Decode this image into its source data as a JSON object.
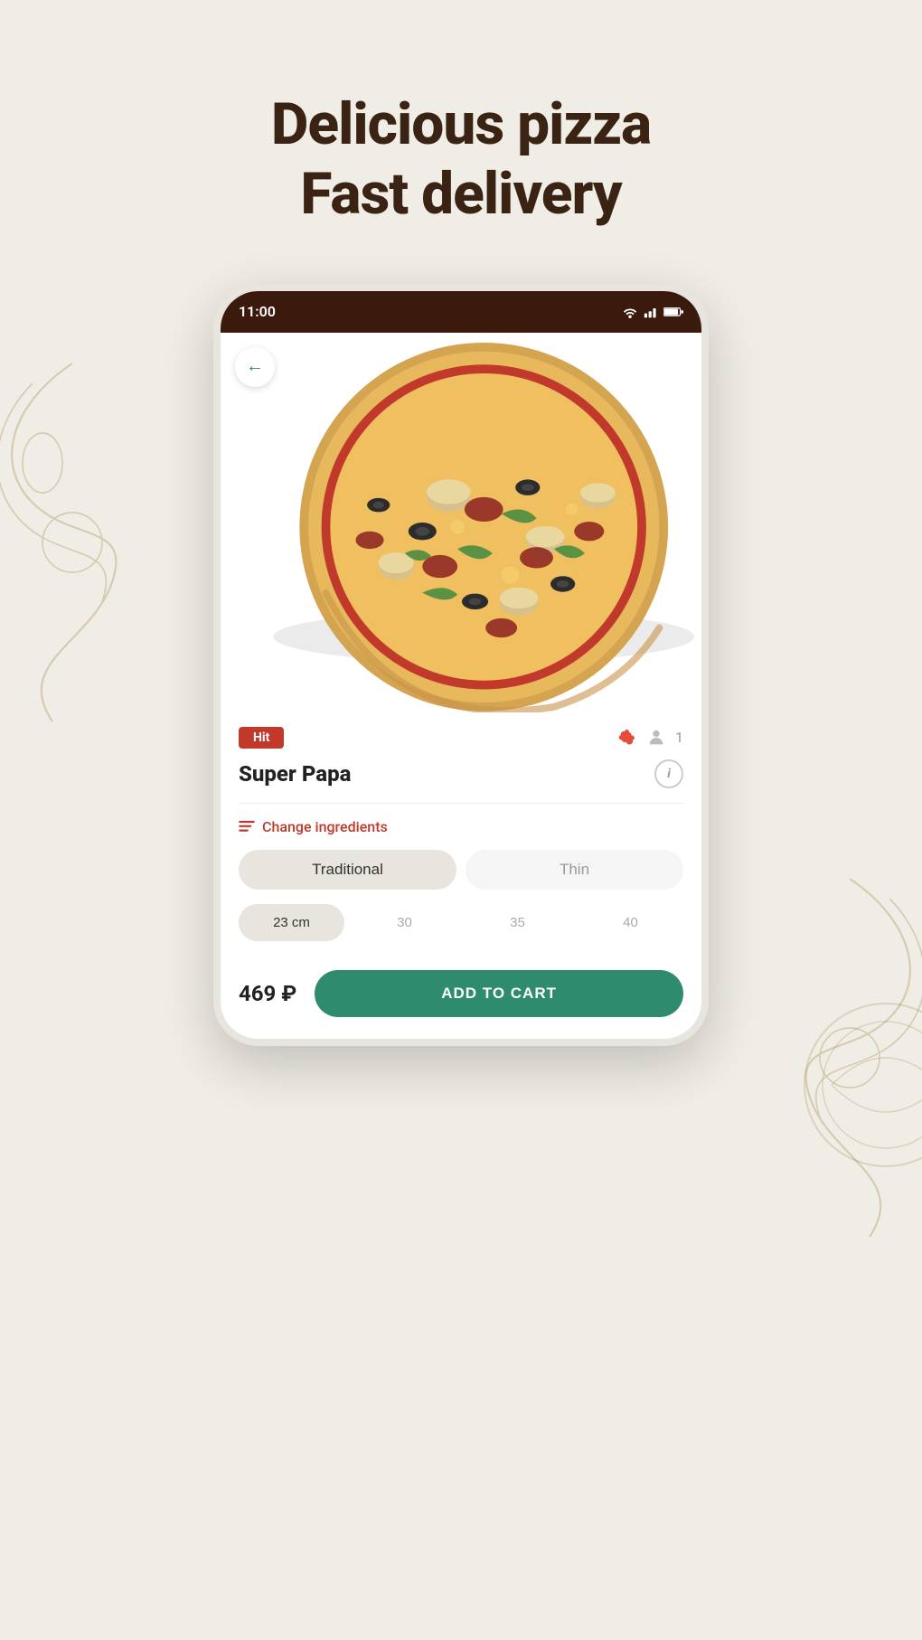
{
  "heading": {
    "line1": "Delicious pizza",
    "line2": "Fast delivery"
  },
  "status_bar": {
    "time": "11:00",
    "wifi": "▼",
    "signal": "▲",
    "battery": "🔋"
  },
  "pizza": {
    "badge": "Hit",
    "title": "Super Papa",
    "info_label": "i",
    "persons": "1",
    "change_ingredients": "Change ingredients",
    "crust_options": [
      {
        "label": "Traditional",
        "active": true
      },
      {
        "label": "Thin",
        "active": false
      }
    ],
    "size_options": [
      {
        "label": "23 cm",
        "active": true
      },
      {
        "label": "30",
        "active": false
      },
      {
        "label": "35",
        "active": false
      },
      {
        "label": "40",
        "active": false
      }
    ],
    "price": "469 ₽",
    "add_to_cart": "ADD TO CART"
  }
}
